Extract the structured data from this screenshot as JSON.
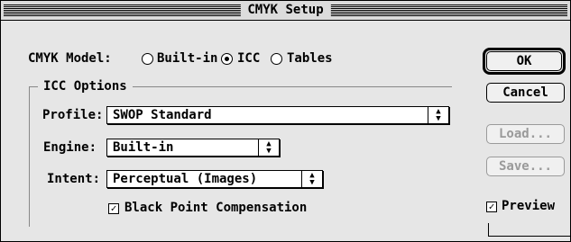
{
  "window": {
    "title": "CMYK Setup"
  },
  "cmyk_model": {
    "label": "CMYK Model:",
    "options": [
      {
        "label": "Built-in",
        "selected": false
      },
      {
        "label": "ICC",
        "selected": true
      },
      {
        "label": "Tables",
        "selected": false
      }
    ]
  },
  "icc_options": {
    "group_title": "ICC Options",
    "profile": {
      "label": "Profile:",
      "value": "SWOP Standard"
    },
    "engine": {
      "label": "Engine:",
      "value": "Built-in"
    },
    "intent": {
      "label": "Intent:",
      "value": "Perceptual (Images)"
    },
    "black_point": {
      "label": "Black Point Compensation",
      "checked": true
    }
  },
  "buttons": {
    "ok": {
      "label": "OK",
      "enabled": true,
      "default": true
    },
    "cancel": {
      "label": "Cancel",
      "enabled": true
    },
    "load": {
      "label": "Load...",
      "enabled": false
    },
    "save": {
      "label": "Save...",
      "enabled": false
    }
  },
  "preview": {
    "label": "Preview",
    "checked": true
  },
  "icons": {
    "popup_arrows": "up-down-arrows-icon",
    "checkmark": "checkmark-icon"
  }
}
